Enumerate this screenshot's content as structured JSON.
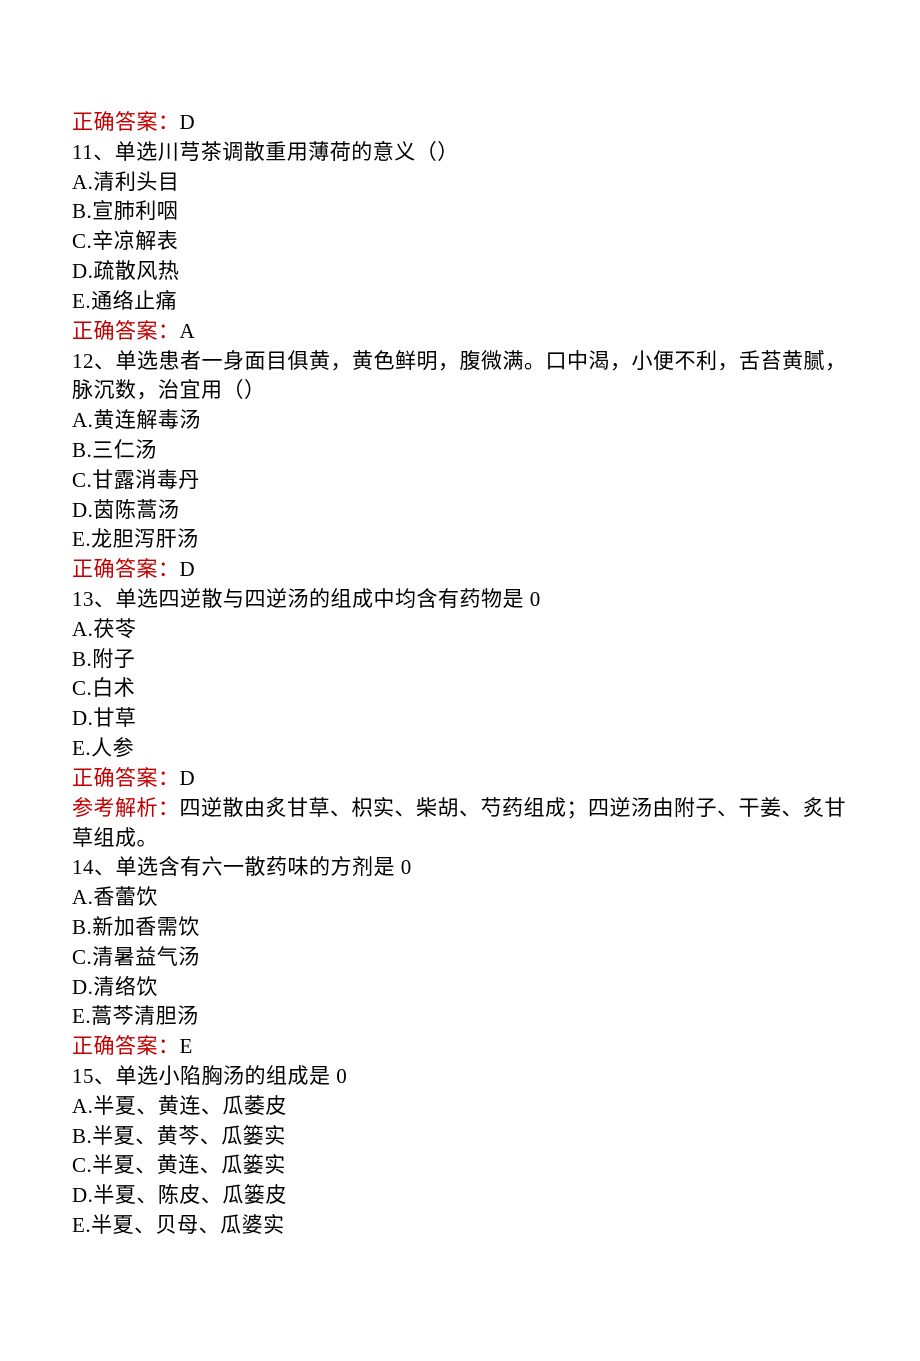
{
  "labels": {
    "correct_answer": "正确答案：",
    "analysis": "参考解析："
  },
  "prev_answer": "D",
  "questions": [
    {
      "num": "11",
      "head": "、单选川芎茶调散重用薄荷的意义（）",
      "options": [
        "A.清利头目",
        "B.宣肺利咽",
        "C.辛凉解表",
        "D.疏散风热",
        "E.通络止痛"
      ],
      "answer": "A"
    },
    {
      "num": "12",
      "head": "、单选患者一身面目俱黄，黄色鲜明，腹微满。口中渴，小便不利，舌苔黄腻，脉沉数，治宜用（）",
      "options": [
        "A.黄连解毒汤",
        "B.三仁汤",
        "C.甘露消毒丹",
        "D.茵陈蒿汤",
        "E.龙胆泻肝汤"
      ],
      "answer": "D"
    },
    {
      "num": "13",
      "head": "、单选四逆散与四逆汤的组成中均含有药物是 0",
      "options": [
        "A.茯苓",
        "B.附子",
        "C.白术",
        "D.甘草",
        "E.人参"
      ],
      "answer": "D",
      "analysis": "四逆散由炙甘草、枳实、柴胡、芍药组成；四逆汤由附子、干姜、炙甘草组成。"
    },
    {
      "num": "14",
      "head": "、单选含有六一散药味的方剂是 0",
      "options": [
        "A.香蕾饮",
        "B.新加香需饮",
        "C.清暑益气汤",
        "D.清络饮",
        "E.蒿芩清胆汤"
      ],
      "answer": "E"
    },
    {
      "num": "15",
      "head": "、单选小陷胸汤的组成是 0",
      "options": [
        "A.半夏、黄连、瓜萎皮",
        "B.半夏、黄芩、瓜篓实",
        "C.半夏、黄连、瓜篓实",
        "D.半夏、陈皮、瓜篓皮",
        "E.半夏、贝母、瓜婆实"
      ]
    }
  ]
}
